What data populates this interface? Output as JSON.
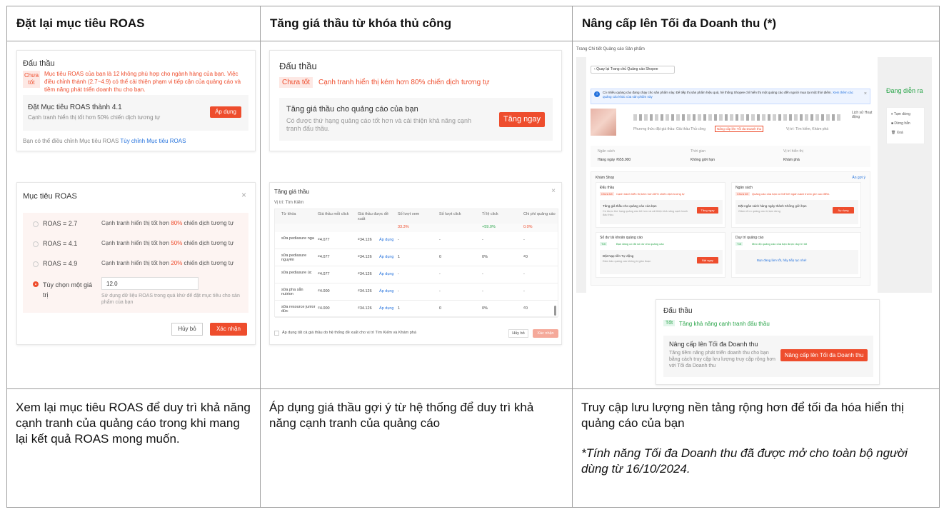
{
  "columns": [
    {
      "header": "Đặt lại mục tiêu ROAS",
      "description": "Xem lại mục tiêu ROAS để duy trì khả năng cạnh tranh của quảng cáo trong khi mang lại kết quả ROAS mong muốn.",
      "note": ""
    },
    {
      "header": "Tăng giá thầu từ khóa thủ công",
      "description": "Áp dụng giá thầu gợi ý từ hệ thống để duy trì khả năng cạnh tranh của quảng cáo",
      "note": ""
    },
    {
      "header": "Nâng cấp lên Tối đa Doanh thu (*)",
      "description": "Truy cập lưu lượng nền tảng rộng hơn để tối đa hóa hiển thị quảng cáo của bạn",
      "note": "*Tính năng Tối đa Doanh thu đã được mở cho toàn bộ người dùng từ 16/10/2024."
    }
  ],
  "col1": {
    "card_title": "Đấu thầu",
    "badge": "Chưa tốt",
    "warning": "Mục tiêu ROAS của bạn là 12 không phù hợp cho ngành hàng của bạn. Việc điều chỉnh thành (2.7~4.9) có thể cải thiện phạm vi tiếp cận của quảng cáo và tiềm năng phát triển doanh thu cho bạn.",
    "suggest_title": "Đặt Mục tiêu ROAS thành 4.1",
    "suggest_sub": "Cạnh tranh hiển thị tốt hơn 50% chiến dịch tương tự",
    "apply_btn": "Áp dụng",
    "footer_text": "Bạn có thể điều chỉnh Mục tiêu ROAS ",
    "footer_link": "Tùy chỉnh Mục tiêu ROAS",
    "modal_title": "Mục tiêu ROAS",
    "options": [
      {
        "label": "ROAS = 2.7",
        "desc_pre": "Cạnh tranh hiển thị tốt hơn ",
        "pct": "80%",
        "desc_post": " chiến dịch tương tự"
      },
      {
        "label": "ROAS = 4.1",
        "desc_pre": "Cạnh tranh hiển thị tốt hơn ",
        "pct": "50%",
        "desc_post": " chiến dịch tương tự"
      },
      {
        "label": "ROAS = 4.9",
        "desc_pre": "Cạnh tranh hiển thị tốt hơn ",
        "pct": "20%",
        "desc_post": " chiến dịch tương tự"
      }
    ],
    "custom_label": "Tùy chọn một giá trị",
    "custom_value": "12.0",
    "custom_hint": "Sử dụng dữ liệu ROAS trong quá khứ để đặt mục tiêu cho sản phẩm của bạn",
    "cancel": "Hủy bỏ",
    "confirm": "Xác nhận"
  },
  "col2": {
    "card_title": "Đấu thầu",
    "badge": "Chưa tốt",
    "warning": "Cạnh tranh hiển thị kém hơn 80% chiến dịch tương tự",
    "suggest_title": "Tăng giá thầu cho quảng cáo của bạn",
    "suggest_sub": "Có được thứ hạng quảng cáo tốt hơn và cải thiện khả năng cạnh tranh đấu thầu.",
    "boost_btn": "Tăng ngay",
    "modal_title": "Tăng giá thầu",
    "location": "Vị trí: Tìm Kiếm",
    "table_headers": [
      "Từ khóa",
      "Giá thầu mỗi click",
      "Giá thầu được đề xuất",
      "Số lượt xem",
      "Số lượt click",
      "Tỉ lệ click",
      "Chi phí quảng cáo"
    ],
    "sub_row": [
      "33.3%",
      "+59.0%",
      "0.0%"
    ],
    "rows": [
      [
        "sữa pediasure nga",
        "₫4.077",
        "₫34.126",
        "Áp dụng",
        "-",
        "-",
        "-",
        "-"
      ],
      [
        "sữa pediasure nguyên",
        "₫4.077",
        "₫34.126",
        "Áp dụng",
        "1",
        "0",
        "0%",
        "₫0"
      ],
      [
        "sữa pediasure úc",
        "₫4.077",
        "₫34.126",
        "Áp dụng",
        "-",
        "-",
        "-",
        "-"
      ],
      [
        "sữa pha sẵn nutrion",
        "₫4.000",
        "₫34.126",
        "Áp dụng",
        "-",
        "-",
        "-",
        "-"
      ],
      [
        "sữa resource junior đức",
        "₫4.000",
        "₫34.126",
        "Áp dụng",
        "1",
        "0",
        "0%",
        "₫0"
      ]
    ],
    "footer_check": "Áp dụng tất cả giá thầu do hệ thống đề xuất cho vị trí Tìm Kiếm và Khám phá",
    "cancel": "Hủy bỏ",
    "confirm": "Xác nhận"
  },
  "col3": {
    "page_title": "Trang Chi tiết Quảng cáo Sản phẩm",
    "back_btn": "Quay lại Trang chủ Quảng cáo Shopee",
    "info_text": "Có nhiều quảng cáo đang chạy cho sản phẩm này. Để tiếp thị sản phẩm hiệu quả, hệ thống Shopee chỉ hiển thị một quảng cáo đến người mua tại một thời điểm.",
    "info_link": "Xem thêm các quảng cáo khác của sản phẩm này",
    "status": "Đang diễn ra",
    "side_actions": [
      "Tạm dừng",
      "Dừng hẳn",
      "Xoá"
    ],
    "history": "Lịch sử Hoạt động",
    "meta": [
      "Phương thức đặt giá thầu: Giá thầu Thủ công",
      "Vị trí: Tìm kiếm, Khám phá"
    ],
    "meta_warn": "Nâng cấp lên Tối đa Doanh thu",
    "budget_labels": [
      "Ngân sách",
      "Thời gian",
      "Vị trí hiển thị"
    ],
    "budget_values": [
      "Hàng ngày ₫655.000",
      "Không giới hạn",
      "Khám phá"
    ],
    "explore_title": "Khám Shop",
    "collapse": "Ẩn gợi ý",
    "panels": [
      {
        "title": "Đấu thầu",
        "tag": "Chưa tốt",
        "warn": "Cạnh tranh hiển thị kém hơn 80% chiến dịch tương tự",
        "sub_title": "Tăng giá thầu cho quảng cáo của bạn",
        "sub_desc": "Có được thứ hạng quảng cáo tốt hơn và cải thiện khả năng cạnh tranh đấu thầu.",
        "btn": "Tăng ngay"
      },
      {
        "title": "Ngân sách",
        "tag": "Chưa tốt",
        "warn": "Quảng cáo của bạn có thể hết ngân sách trước giờ cao điểm.",
        "sub_title": "Đặt ngân sách hàng ngày thành Không giới hạn",
        "sub_desc": "Giảm rủi ro quảng cáo bị tạm dừng",
        "btn": "Áp dụng"
      },
      {
        "title": "Số dư tài khoản quảng cáo",
        "tag": "Tốt",
        "warn": "Bạn đang có đủ số dư cho quảng cáo",
        "sub_title": "Đặt Nạp tiền Tự động",
        "sub_desc": "Đảm bảo quảng cáo không bị gián đoạn",
        "btn": "Bật ngay"
      },
      {
        "title": "Duy trì quảng cáo",
        "tag": "Tốt",
        "warn": "Mức độ quảng cáo của bạn được duy trì tốt",
        "sub_title": "Bạn đang làm tốt, hãy tiếp tục nhé!",
        "sub_desc": "",
        "btn": ""
      }
    ],
    "bottom_title": "Đấu thầu",
    "bottom_tag": "Tốt",
    "bottom_warn": "Tăng khả năng cạnh tranh đấu thầu",
    "bottom_sub_title": "Nâng cấp lên Tối đa Doanh thu",
    "bottom_sub_desc": "Tăng tiềm năng phát triển doanh thu cho bạn bằng cách truy cập lưu lượng truy cập rộng hơn với Tối đa Doanh thu",
    "bottom_btn": "Nâng cấp lên Tối đa Doanh thu"
  }
}
